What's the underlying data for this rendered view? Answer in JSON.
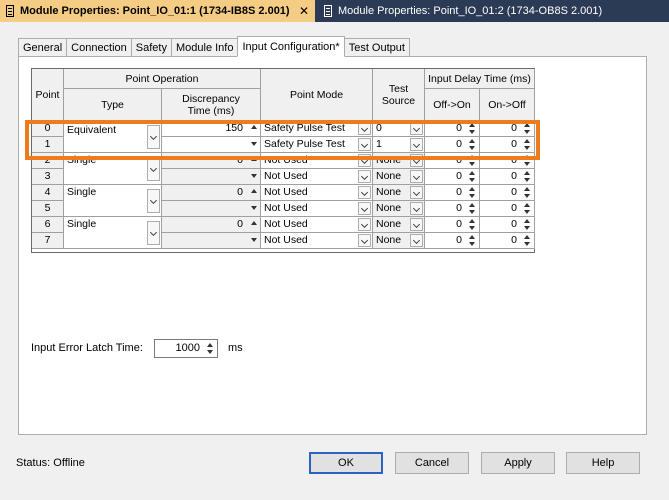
{
  "doc_tabs": [
    {
      "title": "Module Properties: Point_IO_01:1 (1734-IB8S 2.001)",
      "close": "✕"
    },
    {
      "title": "Module Properties: Point_IO_01:2 (1734-OB8S 2.001)"
    }
  ],
  "prop_tabs": [
    "General",
    "Connection",
    "Safety",
    "Module Info",
    "Input Configuration*",
    "Test Output"
  ],
  "table": {
    "headers": {
      "point": "Point",
      "point_operation": "Point Operation",
      "type": "Type",
      "discrepancy": "Discrepancy Time (ms)",
      "point_mode": "Point Mode",
      "test_source": "Test Source",
      "input_delay": "Input Delay Time (ms)",
      "off_on": "Off->On",
      "on_off": "On->Off"
    },
    "pairs": [
      {
        "type": "Equivalent",
        "discrepancy": "150"
      },
      {
        "type": "Single",
        "discrepancy": "0"
      },
      {
        "type": "Single",
        "discrepancy": "0"
      },
      {
        "type": "Single",
        "discrepancy": "0"
      }
    ],
    "rows": [
      {
        "point": "0",
        "mode": "Safety Pulse Test",
        "source": "0",
        "off_on": "0",
        "on_off": "0"
      },
      {
        "point": "1",
        "mode": "Safety Pulse Test",
        "source": "1",
        "off_on": "0",
        "on_off": "0"
      },
      {
        "point": "2",
        "mode": "Not Used",
        "source": "None",
        "off_on": "0",
        "on_off": "0"
      },
      {
        "point": "3",
        "mode": "Not Used",
        "source": "None",
        "off_on": "0",
        "on_off": "0"
      },
      {
        "point": "4",
        "mode": "Not Used",
        "source": "None",
        "off_on": "0",
        "on_off": "0"
      },
      {
        "point": "5",
        "mode": "Not Used",
        "source": "None",
        "off_on": "0",
        "on_off": "0"
      },
      {
        "point": "6",
        "mode": "Not Used",
        "source": "None",
        "off_on": "0",
        "on_off": "0"
      },
      {
        "point": "7",
        "mode": "Not Used",
        "source": "None",
        "off_on": "0",
        "on_off": "0"
      }
    ]
  },
  "latch": {
    "label": "Input Error Latch Time:",
    "value": "1000",
    "unit": "ms"
  },
  "status": "Status:  Offline",
  "buttons": {
    "ok": "OK",
    "cancel": "Cancel",
    "apply": "Apply",
    "help": "Help"
  },
  "colors": {
    "active_doc_tab": "#f5cc84",
    "doc_tab_bar": "#2b3a55",
    "highlight": "#f07b1a",
    "default_button_border": "#2a63c0"
  }
}
